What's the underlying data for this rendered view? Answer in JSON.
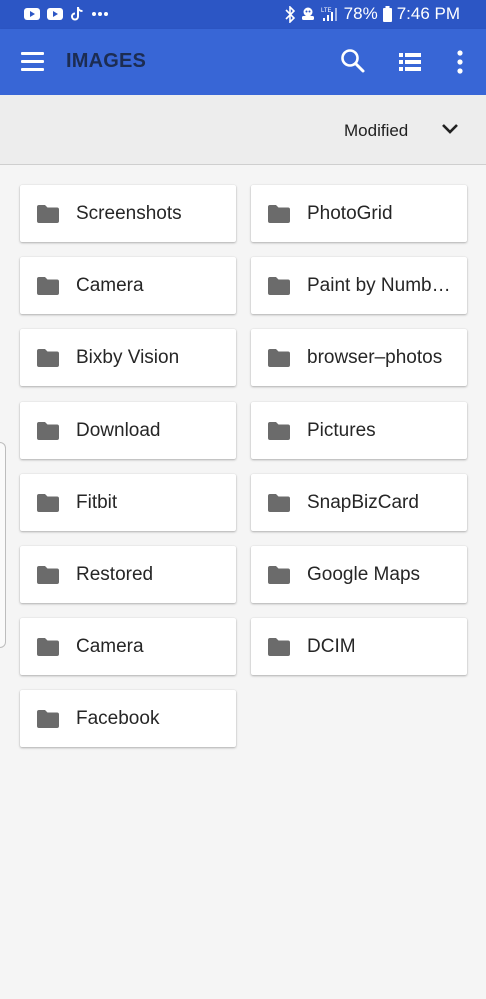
{
  "status_bar": {
    "notification_icons": [
      "youtube-icon",
      "youtube-icon",
      "tiktok-icon",
      "more-dots-icon"
    ],
    "indicator_icons": [
      "bluetooth-icon",
      "notification-icon",
      "signal-icon"
    ],
    "battery_percent": "78%",
    "time": "7:46 PM",
    "signal_label": "LTE"
  },
  "app_bar": {
    "title": "IMAGES",
    "menu_icon": "hamburger-menu-icon",
    "search_icon": "search-icon",
    "view_icon": "list-view-icon",
    "more_icon": "more-vert-icon"
  },
  "sort": {
    "label": "Modified",
    "icon": "chevron-down-icon"
  },
  "folders": [
    {
      "name": "Screenshots"
    },
    {
      "name": "PhotoGrid"
    },
    {
      "name": "Camera"
    },
    {
      "name": "Paint by Numb…"
    },
    {
      "name": "Bixby Vision"
    },
    {
      "name": "browser–photos"
    },
    {
      "name": "Download"
    },
    {
      "name": "Pictures"
    },
    {
      "name": "Fitbit"
    },
    {
      "name": "SnapBizCard"
    },
    {
      "name": "Restored"
    },
    {
      "name": "Google Maps"
    },
    {
      "name": "Camera"
    },
    {
      "name": "DCIM"
    },
    {
      "name": "Facebook"
    }
  ],
  "colors": {
    "status_bar": "#2c56c5",
    "app_bar": "#3866d6",
    "title_text": "#1c2c52",
    "folder_icon": "#6b6b6b",
    "background": "#f5f5f5"
  }
}
